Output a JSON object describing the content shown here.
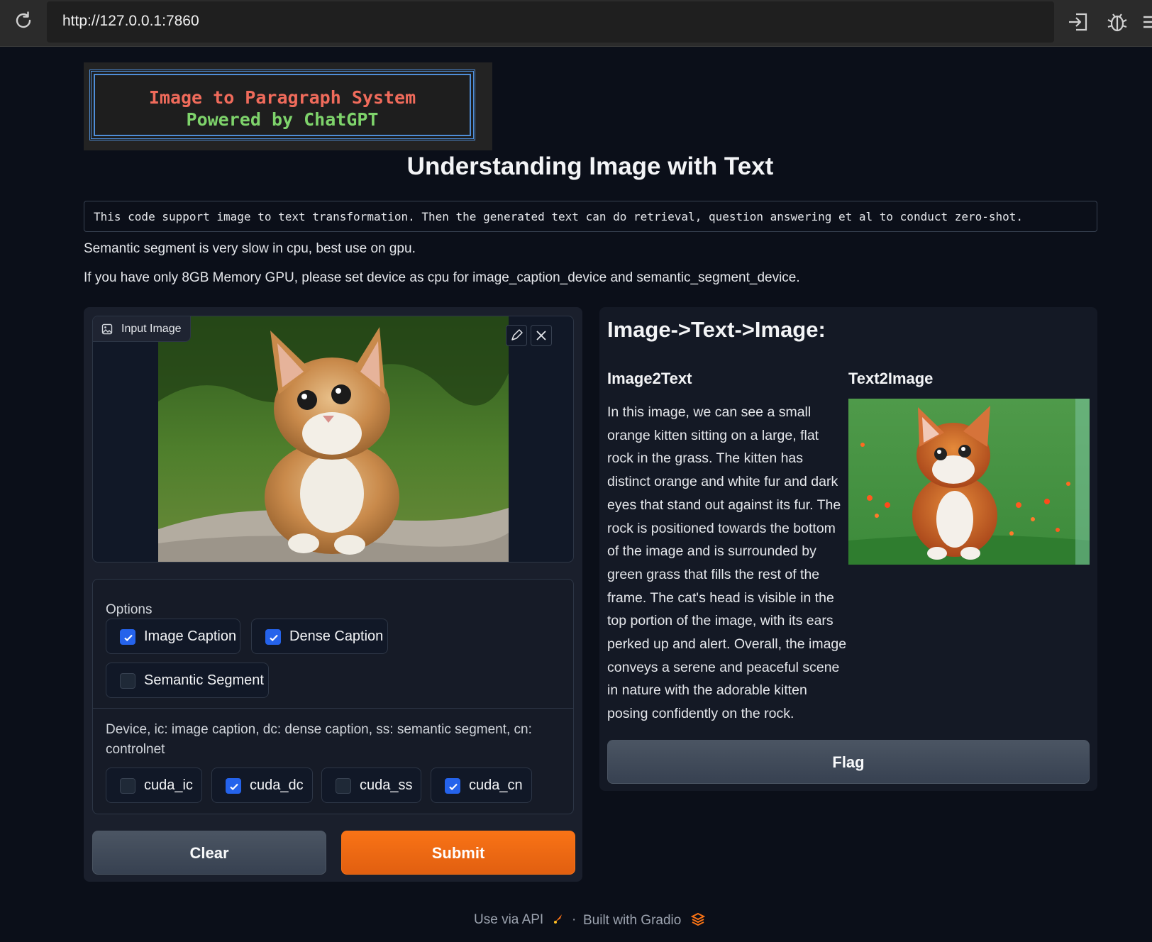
{
  "browser": {
    "url": "http://127.0.0.1:7860"
  },
  "banner": {
    "line1": "Image to Paragraph System",
    "line2": "Powered by ChatGPT"
  },
  "page": {
    "title": "Understanding Image with Text",
    "code_description": "This code support image to text transformation. Then the generated text can do retrieval, question answering et al to conduct zero-shot.",
    "note1": "Semantic segment is very slow in cpu, best use on gpu.",
    "note2": "If you have only 8GB Memory GPU, please set device as cpu for image_caption_device and semantic_segment_device."
  },
  "input_image": {
    "label": "Input Image"
  },
  "options": {
    "title": "Options",
    "items": [
      {
        "label": "Image Caption",
        "checked": true
      },
      {
        "label": "Dense Caption",
        "checked": true
      },
      {
        "label": "Semantic Segment",
        "checked": false
      }
    ],
    "device_title": "Device, ic: image caption, dc: dense caption, ss: semantic segment, cn: controlnet",
    "devices": [
      {
        "label": "cuda_ic",
        "checked": false
      },
      {
        "label": "cuda_dc",
        "checked": true
      },
      {
        "label": "cuda_ss",
        "checked": false
      },
      {
        "label": "cuda_cn",
        "checked": true
      }
    ]
  },
  "buttons": {
    "clear": "Clear",
    "submit": "Submit",
    "flag": "Flag"
  },
  "output": {
    "title": "Image->Text->Image:",
    "image2text_label": "Image2Text",
    "text2image_label": "Text2Image",
    "paragraph": "In this image, we can see a small orange kitten sitting on a large, flat rock in the grass. The kitten has distinct orange and white fur and dark eyes that stand out against its fur. The rock is positioned towards the bottom of the image and is surrounded by green grass that fills the rest of the frame. The cat's head is visible in the top portion of the image, with its ears perked up and alert. Overall, the image conveys a serene and peaceful scene in nature with the adorable kitten posing confidently on the rock."
  },
  "footer": {
    "api": "Use via API",
    "separator": "·",
    "built": "Built with Gradio"
  },
  "colors": {
    "accent": "#f97316",
    "checkbox": "#2563eb",
    "background": "#0b0f19"
  }
}
